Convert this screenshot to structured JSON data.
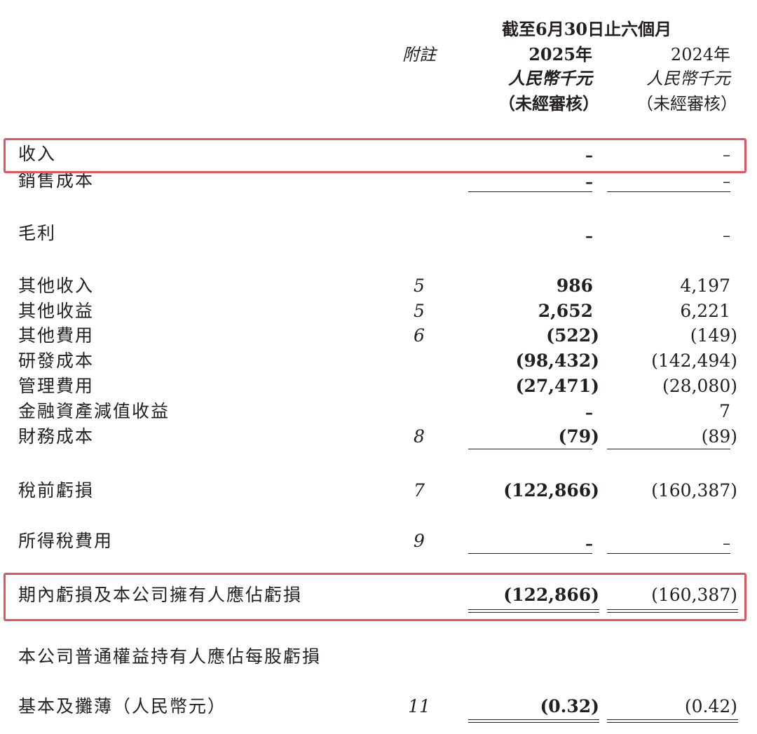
{
  "header": {
    "period": "截至6月30日止六個月",
    "note_col": "附註",
    "col_2025_year": "2025年",
    "col_2024_year": "2024年",
    "col_2025_unit": "人民幣千元",
    "col_2024_unit": "人民幣千元",
    "col_2025_audit": "（未經審核）",
    "col_2024_audit": "（未經審核）"
  },
  "rows": [
    {
      "label": "收入",
      "note": "",
      "v2025": "–",
      "v2024": "–"
    },
    {
      "label": "銷售成本",
      "note": "",
      "v2025": "–",
      "v2024": "–"
    },
    {
      "label": "毛利",
      "note": "",
      "v2025": "–",
      "v2024": "–"
    },
    {
      "label": "其他收入",
      "note": "5",
      "v2025": "986",
      "v2024": "4,197"
    },
    {
      "label": "其他收益",
      "note": "5",
      "v2025": "2,652",
      "v2024": "6,221"
    },
    {
      "label": "其他費用",
      "note": "6",
      "v2025": "(522)",
      "v2024": "(149)"
    },
    {
      "label": "研發成本",
      "note": "",
      "v2025": "(98,432)",
      "v2024": "(142,494)"
    },
    {
      "label": "管理費用",
      "note": "",
      "v2025": "(27,471)",
      "v2024": "(28,080)"
    },
    {
      "label": "金融資產減值收益",
      "note": "",
      "v2025": "–",
      "v2024": "7"
    },
    {
      "label": "財務成本",
      "note": "8",
      "v2025": "(79)",
      "v2024": "(89)"
    },
    {
      "label": "稅前虧損",
      "note": "7",
      "v2025": "(122,866)",
      "v2024": "(160,387)"
    },
    {
      "label": "所得稅費用",
      "note": "9",
      "v2025": "–",
      "v2024": "–"
    },
    {
      "label": "期內虧損及本公司擁有人應佔虧損",
      "note": "",
      "v2025": "(122,866)",
      "v2024": "(160,387)"
    },
    {
      "label": "本公司普通權益持有人應佔每股虧損",
      "note": "",
      "v2025": "",
      "v2024": ""
    },
    {
      "label": "基本及攤薄（人民幣元）",
      "note": "11",
      "v2025": "(0.32)",
      "v2024": "(0.42)"
    }
  ],
  "highlight_color": "#e8525a"
}
